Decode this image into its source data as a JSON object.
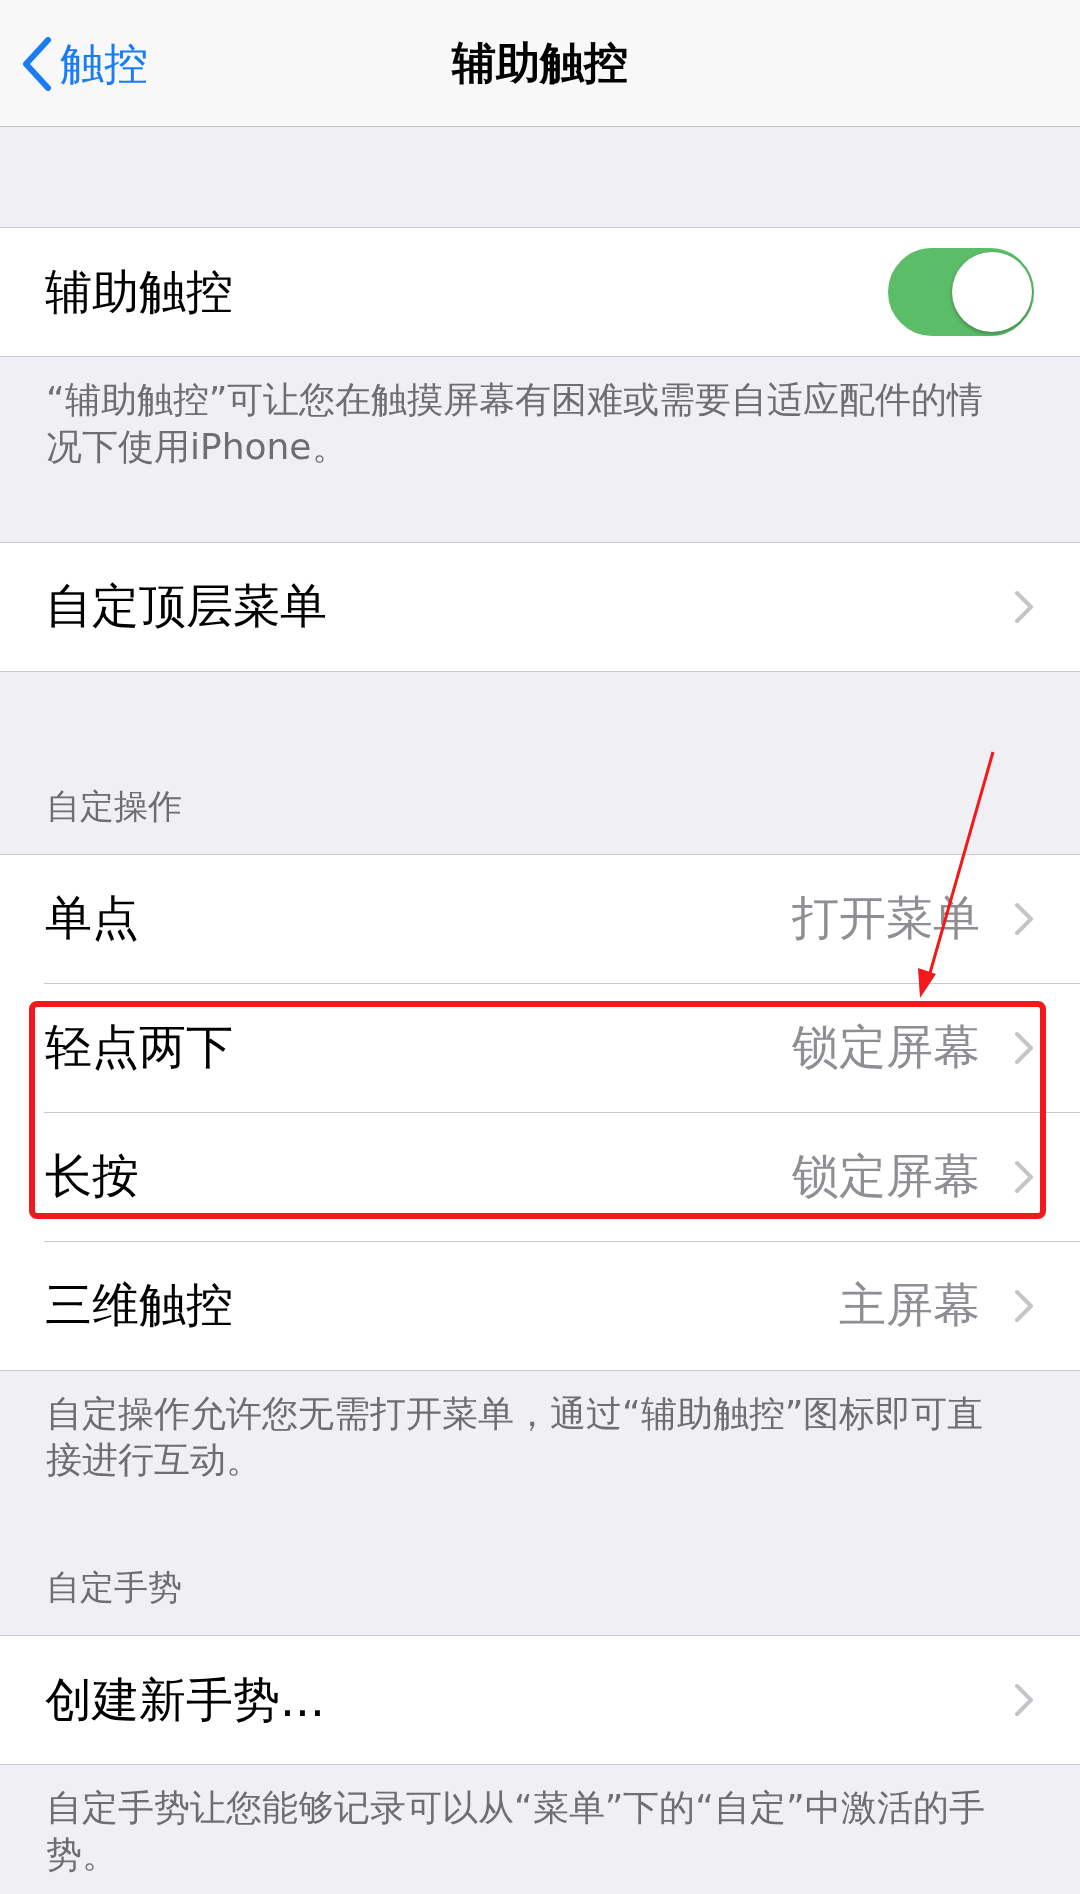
{
  "nav": {
    "back": "触控",
    "title": "辅助触控"
  },
  "sections": [
    {
      "rows": [
        {
          "kind": "toggle",
          "label": "辅助触控",
          "on": true
        }
      ],
      "footer": "“辅助触控”可让您在触摸屏幕有困难或需要自适应配件的情况下使用iPhone。"
    },
    {
      "rows": [
        {
          "kind": "link",
          "label": "自定顶层菜单",
          "highlighted": false
        }
      ]
    },
    {
      "header": "自定操作",
      "rows": [
        {
          "kind": "link",
          "label": "单点",
          "value": "打开菜单",
          "highlighted": false
        },
        {
          "kind": "link",
          "label": "轻点两下",
          "value": "锁定屏幕",
          "highlighted": true
        },
        {
          "kind": "link",
          "label": "长按",
          "value": "锁定屏幕",
          "highlighted": true
        },
        {
          "kind": "link",
          "label": "三维触控",
          "value": "主屏幕",
          "highlighted": false
        }
      ],
      "footer": "自定操作允许您无需打开菜单，通过“辅助触控”图标即可直接进行互动。"
    },
    {
      "header": "自定手势",
      "rows": [
        {
          "kind": "link",
          "label": "创建新手势...",
          "highlighted": false
        }
      ],
      "footer": "自定手势让您能够记录可以从“菜单”下的“自定”中激活的手势。"
    }
  ]
}
